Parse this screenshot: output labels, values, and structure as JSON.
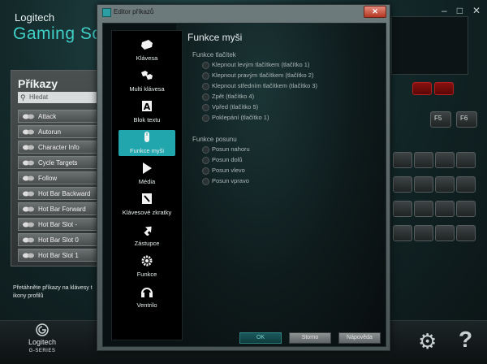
{
  "app": {
    "brand": "Logitech",
    "title": "Gaming Soft",
    "window_controls": [
      "–",
      "□",
      "✕"
    ]
  },
  "commands": {
    "title": "Příkazy",
    "search_placeholder": "Hledat",
    "items": [
      {
        "label": "Attack"
      },
      {
        "label": "Autorun"
      },
      {
        "label": "Character Info"
      },
      {
        "label": "Cycle Targets"
      },
      {
        "label": "Follow"
      },
      {
        "label": "Hot Bar Backward"
      },
      {
        "label": "Hot Bar Forward"
      },
      {
        "label": "Hot Bar Slot -"
      },
      {
        "label": "Hot Bar Slot 0"
      },
      {
        "label": "Hot Bar Slot 1"
      }
    ],
    "hint": "Přetáhněte příkazy na klávesy t ikony profilů"
  },
  "bottom": {
    "logo_text": "Logitech",
    "series": "G-SERIES",
    "help": "?"
  },
  "keyboard": {
    "keys": [
      "F5",
      "F6"
    ]
  },
  "dialog": {
    "title": "Editor příkazů",
    "close": "✕",
    "sidebar": [
      {
        "label": "Klávesa",
        "icon": "key-icon",
        "active": false
      },
      {
        "label": "Multi klávesa",
        "icon": "multikey-icon",
        "active": false
      },
      {
        "label": "Blok textu",
        "icon": "text-block-icon",
        "active": false
      },
      {
        "label": "Funkce myši",
        "icon": "mouse-icon",
        "active": true
      },
      {
        "label": "Média",
        "icon": "play-icon",
        "active": false
      },
      {
        "label": "Klávesové zkratky",
        "icon": "hotkey-icon",
        "active": false
      },
      {
        "label": "Zástupce",
        "icon": "shortcut-arrow-icon",
        "active": false
      },
      {
        "label": "Funkce",
        "icon": "function-gear-icon",
        "active": false
      },
      {
        "label": "Ventrilo",
        "icon": "headset-icon",
        "active": false
      }
    ],
    "panel_title": "Funkce myši",
    "buttons_group": {
      "title": "Funkce tlačítek",
      "options": [
        "Klepnout levým tlačítkem (tlačítko 1)",
        "Klepnout pravým tlačítkem (tlačítko 2)",
        "Klepnout středním tlačítkem (tlačítko 3)",
        "Zpět (tlačítko 4)",
        "Vpřed (tlačítko 5)",
        "Poklepání (tlačítko 1)"
      ]
    },
    "scroll_group": {
      "title": "Funkce posunu",
      "options": [
        "Posun nahoru",
        "Posun dolů",
        "Posun vlevo",
        "Posun vpravo"
      ]
    },
    "ok": "OK",
    "cancel": "Storno",
    "help": "Nápověda"
  }
}
